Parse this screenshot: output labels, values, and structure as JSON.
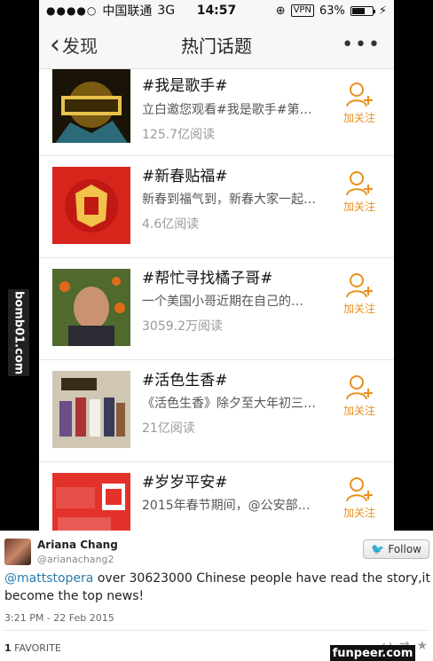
{
  "status_bar": {
    "carrier": "中国联通",
    "network": "3G",
    "time": "14:57",
    "vpn": "VPN",
    "battery": "63%",
    "battery_level": 0.63
  },
  "nav": {
    "back_label": "发现",
    "title": "热门话题",
    "more": "•••"
  },
  "topics": [
    {
      "title": "#我是歌手#",
      "desc": "立白邀您观看#我是歌手#第…",
      "reads": "125.7亿阅读",
      "follow": "加关注",
      "thumb": "singer"
    },
    {
      "title": "#新春贴福#",
      "desc": "新春到福气到，新春大家一起…",
      "reads": "4.6亿阅读",
      "follow": "加关注",
      "thumb": "fu"
    },
    {
      "title": "#帮忙寻找橘子哥#",
      "desc": "一个美国小哥近期在自己的…",
      "reads": "3059.2万阅读",
      "follow": "加关注",
      "thumb": "man"
    },
    {
      "title": "#活色生香#",
      "desc": "《活色生香》除夕至大年初三…",
      "reads": "21亿阅读",
      "follow": "加关注",
      "thumb": "drama"
    },
    {
      "title": "#岁岁平安#",
      "desc": "2015年春节期间，@公安部…",
      "reads": "",
      "follow": "加关注",
      "thumb": "peace"
    }
  ],
  "watermark": "bomb01.com",
  "tweet": {
    "name": "Ariana Chang",
    "handle": "@arianachang2",
    "follow_label": "Follow",
    "mention": "@mattstopera",
    "text": " over 30623000 Chinese people have read the story,it become the top news!",
    "time": "3:21 PM - 22 Feb 2015",
    "fav_count": "1",
    "fav_label": "FAVORITE"
  },
  "footer_watermark": "funpeer.com"
}
